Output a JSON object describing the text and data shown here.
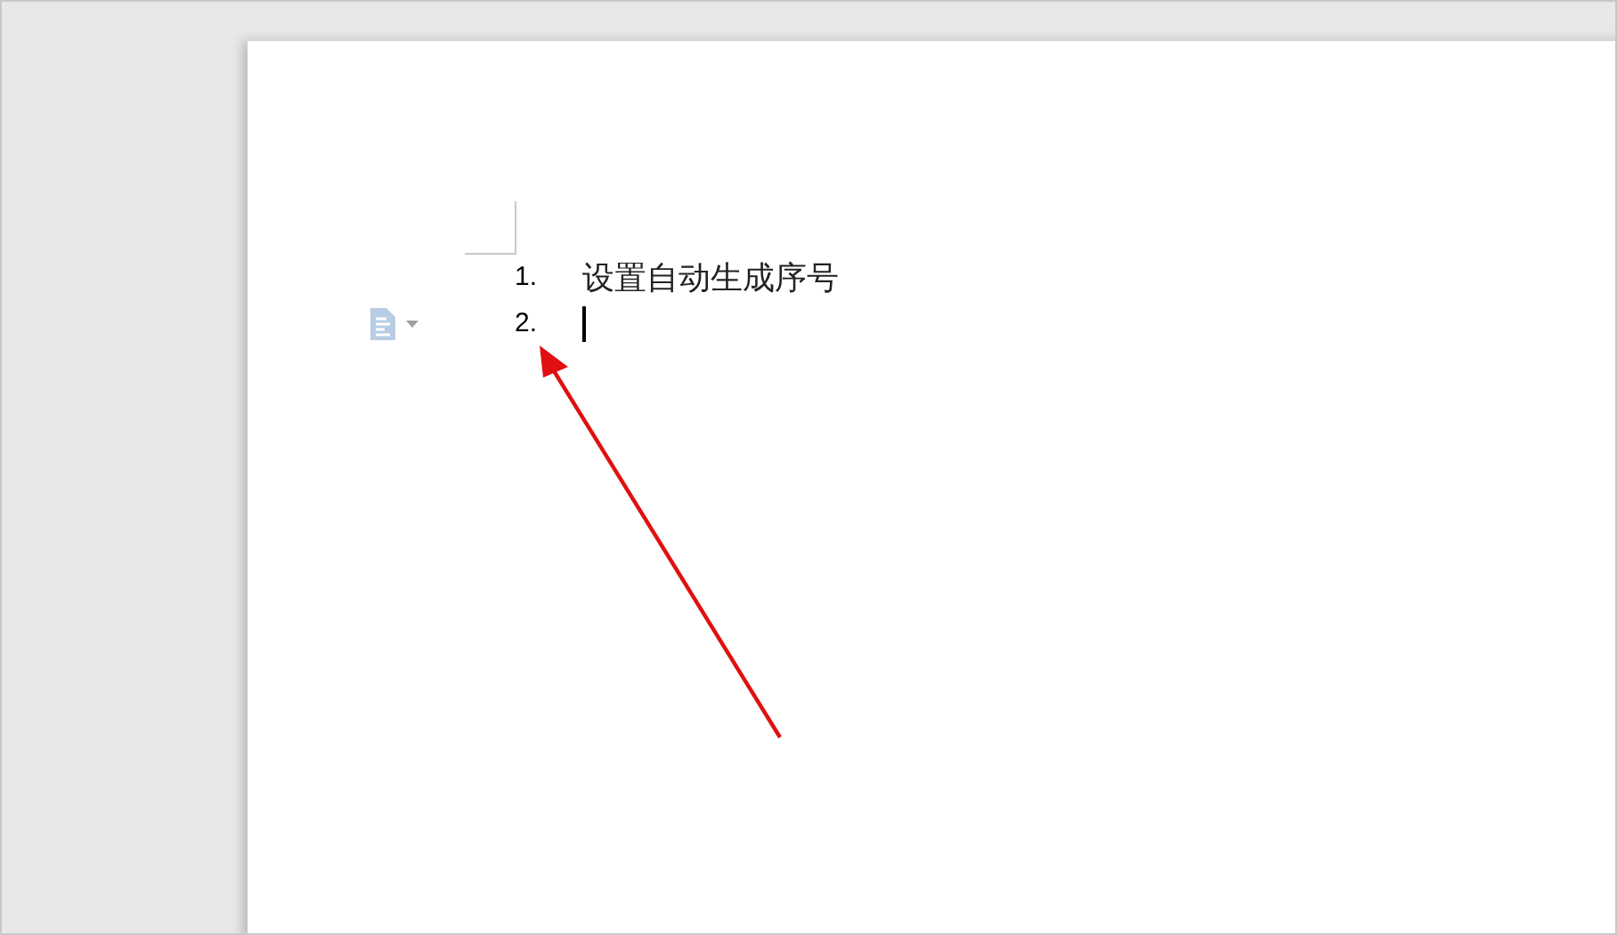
{
  "document": {
    "list": [
      {
        "number": "1.",
        "text": "设置自动生成序号",
        "cursor": false
      },
      {
        "number": "2.",
        "cursor": true
      }
    ]
  }
}
